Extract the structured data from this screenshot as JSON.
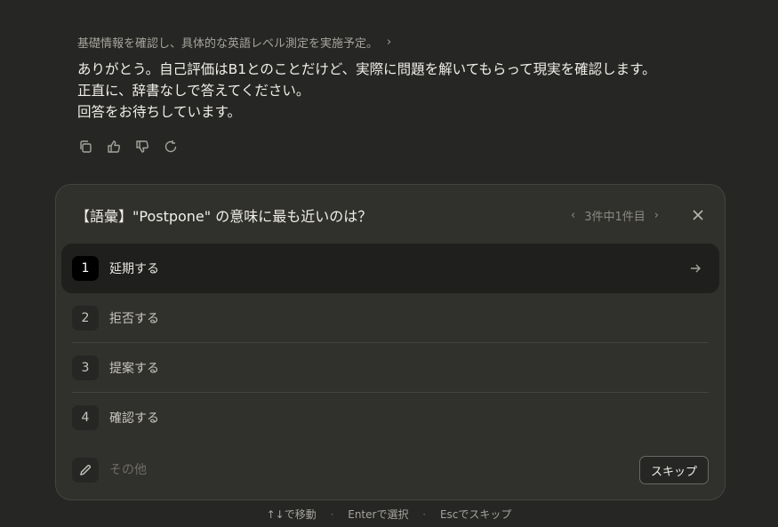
{
  "thinking": {
    "summary": "基礎情報を確認し、具体的な英語レベル測定を実施予定。",
    "chevron_icon": "chevron-right-icon"
  },
  "message": {
    "lines": [
      "ありがとう。自己評価はB1とのことだけど、実際に問題を解いてもらって現実を確認します。",
      "正直に、辞書なしで答えてください。",
      "回答をお待ちしています。"
    ]
  },
  "actions": [
    {
      "name": "copy-icon"
    },
    {
      "name": "thumbs-up-icon"
    },
    {
      "name": "thumbs-down-icon"
    },
    {
      "name": "retry-icon"
    }
  ],
  "question": {
    "title": "【語彙】\"Postpone\" の意味に最も近いのは？",
    "pager": "3件中1件目",
    "options": [
      {
        "number": "1",
        "label": "延期する"
      },
      {
        "number": "2",
        "label": "拒否する"
      },
      {
        "number": "3",
        "label": "提案する"
      },
      {
        "number": "4",
        "label": "確認する"
      }
    ],
    "selected_index": 0,
    "other_placeholder": "その他",
    "skip_label": "スキップ"
  },
  "hints": {
    "move": "↑↓で移動",
    "select": "Enterで選択",
    "skip": "Escでスキップ",
    "separator": "·"
  },
  "colors": {
    "background": "#262624",
    "panel": "#30302d",
    "selected_row": "#1f1f1d",
    "text": "#f0eee8",
    "muted": "#a5a39c"
  }
}
